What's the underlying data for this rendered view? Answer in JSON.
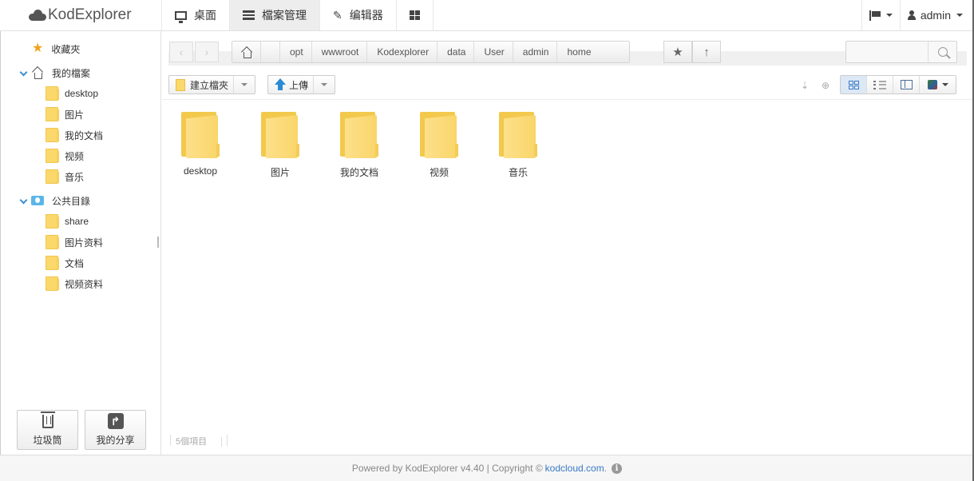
{
  "app": {
    "logo_text": "KodExplorer"
  },
  "topnav": {
    "items": [
      {
        "label": "桌面",
        "icon": "desktop-icon"
      },
      {
        "label": "檔案管理",
        "icon": "files-icon",
        "active": true
      },
      {
        "label": "编辑器",
        "icon": "edit-icon"
      },
      {
        "label": "",
        "icon": "grid-apps-icon"
      }
    ],
    "user_name": "admin"
  },
  "sidebar": {
    "favorites_label": "收藏夾",
    "my_files": {
      "label": "我的檔案",
      "children": [
        "desktop",
        "图片",
        "我的文档",
        "视频",
        "音乐"
      ]
    },
    "public": {
      "label": "公共目錄",
      "children": [
        "share",
        "图片资料",
        "文档",
        "视频资料"
      ]
    },
    "trash_label": "垃圾筒",
    "share_label": "我的分享"
  },
  "pathbar": {
    "crumbs": [
      "opt",
      "wwwroot",
      "Kodexplorer",
      "data",
      "User",
      "admin",
      "home"
    ],
    "search_placeholder": ""
  },
  "toolbar": {
    "new_folder_label": "建立檔夾",
    "upload_label": "上傳"
  },
  "files": [
    {
      "name": "desktop"
    },
    {
      "name": "图片"
    },
    {
      "name": "我的文档"
    },
    {
      "name": "视频"
    },
    {
      "name": "音乐"
    }
  ],
  "status": {
    "count_text": "5個項目"
  },
  "footer": {
    "text": "Powered by KodExplorer v4.40 | Copyright ©",
    "link": "kodcloud.com",
    "period": "."
  },
  "colors": {
    "accent": "#3a79c4",
    "folder": "#fbd86b",
    "star": "#f0a31f"
  }
}
